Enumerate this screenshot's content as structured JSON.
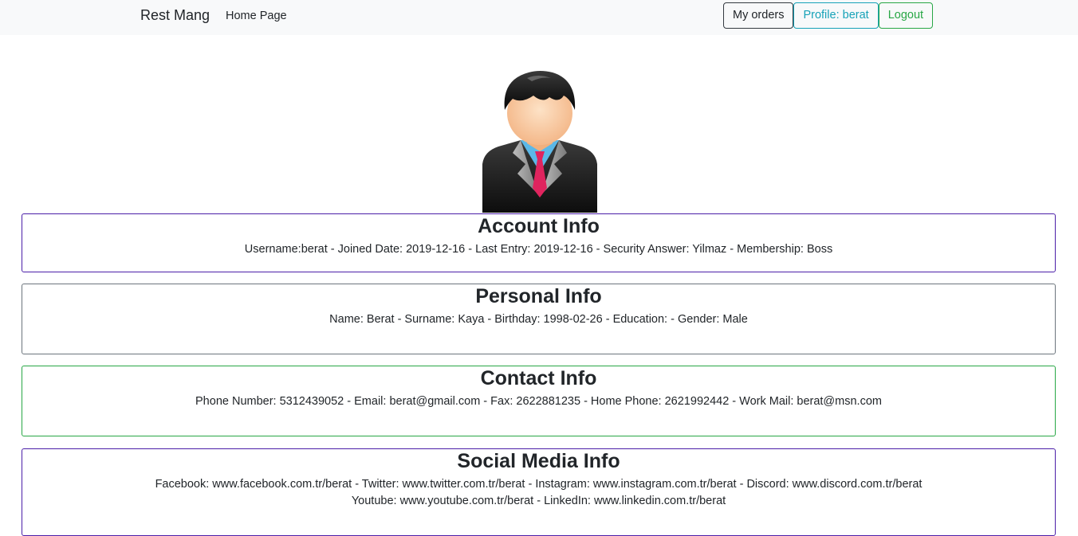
{
  "navbar": {
    "brand": "Rest Mang",
    "home_link": "Home Page",
    "my_orders": "My orders",
    "profile": "Profile: berat",
    "logout": "Logout"
  },
  "avatar": {
    "icon": "user-businessman-avatar"
  },
  "account": {
    "title": "Account Info",
    "line": "Username:berat - Joined Date: 2019-12-16 - Last Entry: 2019-12-16 - Security Answer: Yilmaz - Membership: Boss"
  },
  "personal": {
    "title": "Personal Info",
    "line": "Name: Berat - Surname: Kaya - Birthday: 1998-02-26 - Education: - Gender: Male"
  },
  "contact": {
    "title": "Contact Info",
    "line": "Phone Number: 5312439052 - Email: berat@gmail.com - Fax: 2622881235 - Home Phone: 2621992442 - Work Mail: berat@msn.com"
  },
  "social": {
    "title": "Social Media Info",
    "line1": "Facebook: www.facebook.com.tr/berat - Twitter: www.twitter.com.tr/berat - Instagram: www.instagram.com.tr/berat - Discord: www.discord.com.tr/berat",
    "line2": "Youtube: www.youtube.com.tr/berat - LinkedIn: www.linkedin.com.tr/berat"
  },
  "colors": {
    "navbar_bg": "#f8f9fa",
    "dark": "#343a40",
    "info": "#17a2b8",
    "success": "#28a745",
    "purple_border": "#4b1ea8",
    "secondary_border": "#6c757d"
  }
}
